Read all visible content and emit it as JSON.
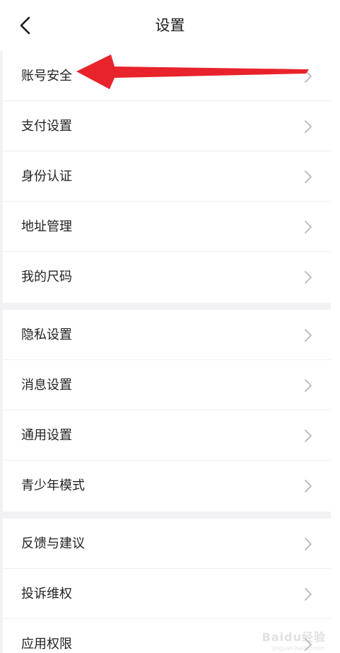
{
  "header": {
    "title": "设置",
    "back_icon": "chevron-left-icon"
  },
  "groups": [
    {
      "items": [
        {
          "label": "账号安全"
        },
        {
          "label": "支付设置"
        },
        {
          "label": "身份认证"
        },
        {
          "label": "地址管理"
        },
        {
          "label": "我的尺码"
        }
      ]
    },
    {
      "items": [
        {
          "label": "隐私设置"
        },
        {
          "label": "消息设置"
        },
        {
          "label": "通用设置"
        },
        {
          "label": "青少年模式"
        }
      ]
    },
    {
      "items": [
        {
          "label": "反馈与建议"
        },
        {
          "label": "投诉维权"
        },
        {
          "label": "应用权限"
        }
      ]
    }
  ],
  "row_icon": "chevron-right-icon",
  "annotation": {
    "type": "red-arrow",
    "points_to": "账号安全",
    "color": "#e8232b"
  },
  "watermark": {
    "brand": "Baidu经验",
    "url": "jingyan.baidu.com"
  },
  "colors": {
    "background": "#f2f2f4",
    "card": "#ffffff",
    "text": "#222222",
    "chevron": "#b8b8bc"
  }
}
